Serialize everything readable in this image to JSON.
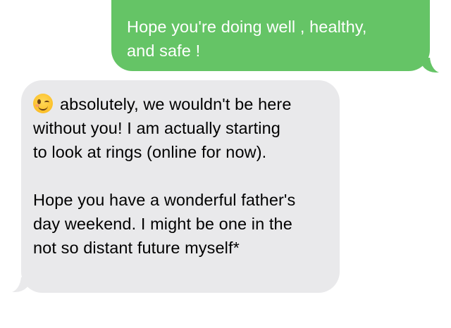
{
  "thread": {
    "sent_message": {
      "lines": [
        "Hope you're doing well , healthy,",
        "and safe !"
      ],
      "color": "#65c466"
    },
    "received_message": {
      "emoji": "winking-face-emoji",
      "paragraph1": [
        "absolutely, we wouldn't be here",
        "without you! I am actually starting",
        "to look at rings (online for now)."
      ],
      "paragraph2": [
        "Hope you have a wonderful father's",
        "day weekend. I might be one in the",
        "not so distant future myself*"
      ],
      "color": "#e9e9eb"
    }
  }
}
